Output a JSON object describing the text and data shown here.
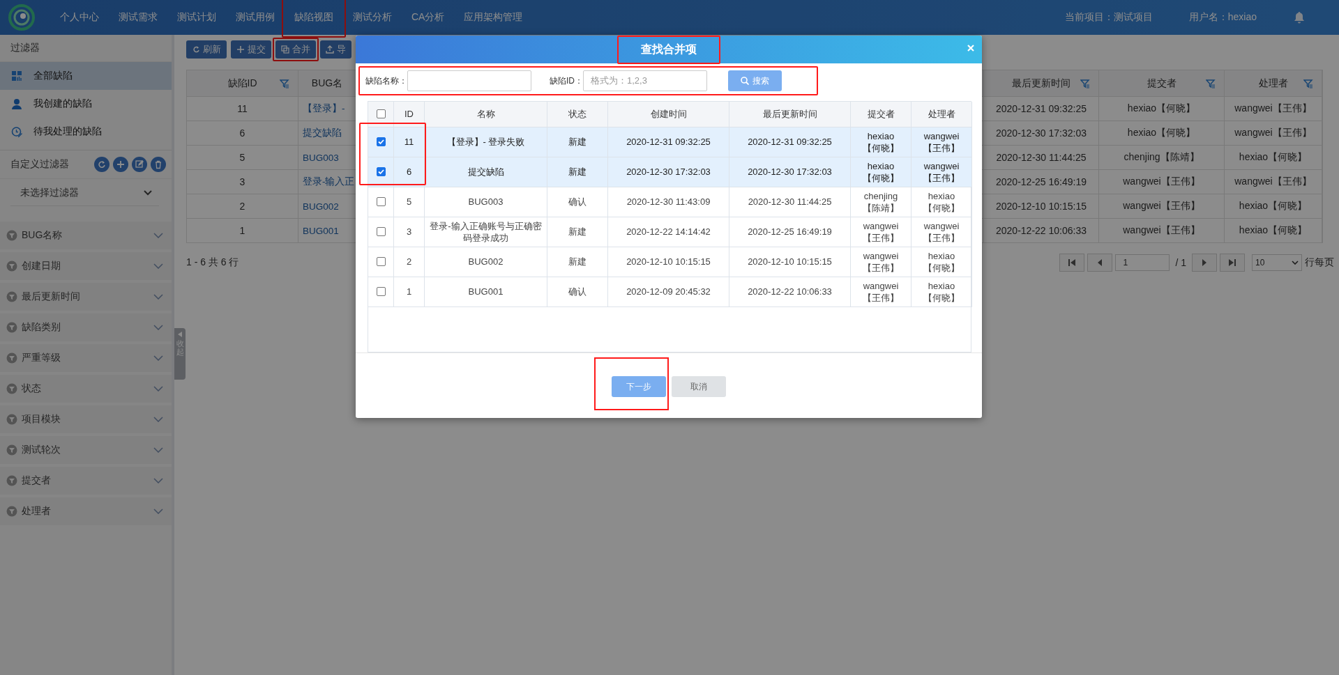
{
  "nav": {
    "items": [
      {
        "label": "个人中心",
        "highlighted": false
      },
      {
        "label": "测试需求",
        "highlighted": false
      },
      {
        "label": "测试计划",
        "highlighted": false
      },
      {
        "label": "测试用例",
        "highlighted": false
      },
      {
        "label": "缺陷视图",
        "highlighted": true
      },
      {
        "label": "测试分析",
        "highlighted": false
      },
      {
        "label": "CA分析",
        "highlighted": false
      },
      {
        "label": "应用架构管理",
        "highlighted": false
      }
    ],
    "project": "当前项目：测试项目",
    "user": "用户名：hexiao"
  },
  "sidebar": {
    "title": "过滤器",
    "quick_filters": [
      {
        "label": "全部缺陷",
        "selected": true
      },
      {
        "label": "我创建的缺陷",
        "selected": false
      },
      {
        "label": "待我处理的缺陷",
        "selected": false
      }
    ],
    "custom_filter_label": "自定义过滤器",
    "custom_filter_select": "未选择过滤器",
    "filter_groups": [
      "BUG名称",
      "创建日期",
      "最后更新时间",
      "缺陷类别",
      "严重等级",
      "状态",
      "项目模块",
      "测试轮次",
      "提交者",
      "处理者"
    ],
    "collapse_handle": "收起"
  },
  "toolbar": [
    {
      "label": "刷新",
      "highlighted": false
    },
    {
      "label": "提交",
      "highlighted": false
    },
    {
      "label": "合并",
      "highlighted": true
    },
    {
      "label": "导",
      "highlighted": false
    }
  ],
  "defect_table": {
    "columns": [
      "缺陷ID",
      "BUG名",
      "最后更新时间",
      "提交者",
      "处理者"
    ],
    "rows": [
      {
        "id": "11",
        "name": "【登录】-",
        "updated": "2020-12-31 09:32:25",
        "submitter": "hexiao【何晓】",
        "handler": "wangwei【王伟】"
      },
      {
        "id": "6",
        "name": "提交缺陷",
        "updated": "2020-12-30 17:32:03",
        "submitter": "hexiao【何晓】",
        "handler": "wangwei【王伟】"
      },
      {
        "id": "5",
        "name": "BUG003",
        "updated": "2020-12-30 11:44:25",
        "submitter": "chenjing【陈靖】",
        "handler": "hexiao【何晓】"
      },
      {
        "id": "3",
        "name": "登录-输入正",
        "updated": "2020-12-25 16:49:19",
        "submitter": "wangwei【王伟】",
        "handler": "wangwei【王伟】"
      },
      {
        "id": "2",
        "name": "BUG002",
        "updated": "2020-12-10 10:15:15",
        "submitter": "wangwei【王伟】",
        "handler": "hexiao【何晓】"
      },
      {
        "id": "1",
        "name": "BUG001",
        "updated": "2020-12-22 10:06:33",
        "submitter": "wangwei【王伟】",
        "handler": "hexiao【何晓】"
      }
    ]
  },
  "pagination": {
    "summary": "1 - 6 共 6 行",
    "page": "1",
    "total": "/ 1",
    "page_size": "10",
    "page_size_label": "行每页"
  },
  "dialog": {
    "title": "查找合并项",
    "title_highlighted": true,
    "search_highlighted": true,
    "name_label": "缺陷名称：",
    "id_label": "缺陷ID：",
    "id_placeholder": "格式为：1,2,3",
    "search_button": "搜索",
    "selection_highlighted": true,
    "all_checked": false,
    "columns": [
      "ID",
      "名称",
      "状态",
      "创建时间",
      "最后更新时间",
      "提交者",
      "处理者"
    ],
    "rows": [
      {
        "id": "11",
        "name": "【登录】- 登录失败",
        "status": "新建",
        "created": "2020-12-31 09:32:25",
        "updated": "2020-12-31 09:32:25",
        "submitter": "hexiao【何晓】",
        "handler": "wangwei【王伟】",
        "checked": true
      },
      {
        "id": "6",
        "name": "提交缺陷",
        "status": "新建",
        "created": "2020-12-30 17:32:03",
        "updated": "2020-12-30 17:32:03",
        "submitter": "hexiao【何晓】",
        "handler": "wangwei【王伟】",
        "checked": true
      },
      {
        "id": "5",
        "name": "BUG003",
        "status": "确认",
        "created": "2020-12-30 11:43:09",
        "updated": "2020-12-30 11:44:25",
        "submitter": "chenjing【陈靖】",
        "handler": "hexiao【何晓】",
        "checked": false
      },
      {
        "id": "3",
        "name": "登录-输入正确账号与正确密码登录成功",
        "status": "新建",
        "created": "2020-12-22 14:14:42",
        "updated": "2020-12-25 16:49:19",
        "submitter": "wangwei【王伟】",
        "handler": "wangwei【王伟】",
        "checked": false
      },
      {
        "id": "2",
        "name": "BUG002",
        "status": "新建",
        "created": "2020-12-10 10:15:15",
        "updated": "2020-12-10 10:15:15",
        "submitter": "wangwei【王伟】",
        "handler": "hexiao【何晓】",
        "checked": false
      },
      {
        "id": "1",
        "name": "BUG001",
        "status": "确认",
        "created": "2020-12-09 20:45:32",
        "updated": "2020-12-22 10:06:33",
        "submitter": "wangwei【王伟】",
        "handler": "hexiao【何晓】",
        "checked": false
      }
    ],
    "next_button": "下一步",
    "next_highlighted": true,
    "cancel_button": "取消"
  }
}
